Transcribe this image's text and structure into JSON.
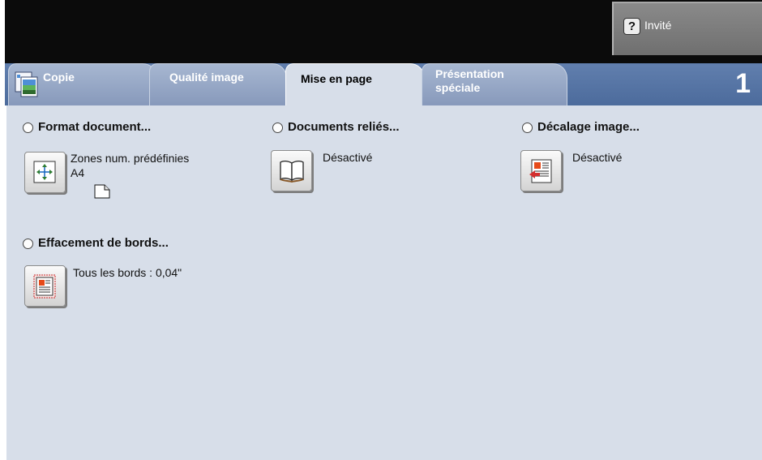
{
  "header": {
    "user_label": "Invité",
    "help_icon": "help-icon"
  },
  "tabs": [
    {
      "label": "Copie",
      "active": false,
      "icon": "copy-icon"
    },
    {
      "label": "Qualité image",
      "active": false
    },
    {
      "label": "Mise en page",
      "active": true
    },
    {
      "label_line1": "Présentation",
      "label_line2": "spéciale",
      "active": false
    }
  ],
  "page_number": "1",
  "sections": {
    "format": {
      "title": "Format document...",
      "value_line1": "Zones num. prédéfinies",
      "value_line2": "A4",
      "icon": "scan-area-icon"
    },
    "bound": {
      "title": "Documents reliés...",
      "value": "Désactivé",
      "icon": "open-book-icon"
    },
    "shift": {
      "title": "Décalage image...",
      "value": "Désactivé",
      "icon": "image-shift-icon"
    },
    "erase": {
      "title": "Effacement de bords...",
      "value": "Tous les bords : 0,04\"",
      "icon": "edge-erase-icon"
    }
  },
  "colors": {
    "tab_bar": "#4c6b9c",
    "content_bg": "#d7dee9",
    "header_bg": "#0b0b0b"
  }
}
